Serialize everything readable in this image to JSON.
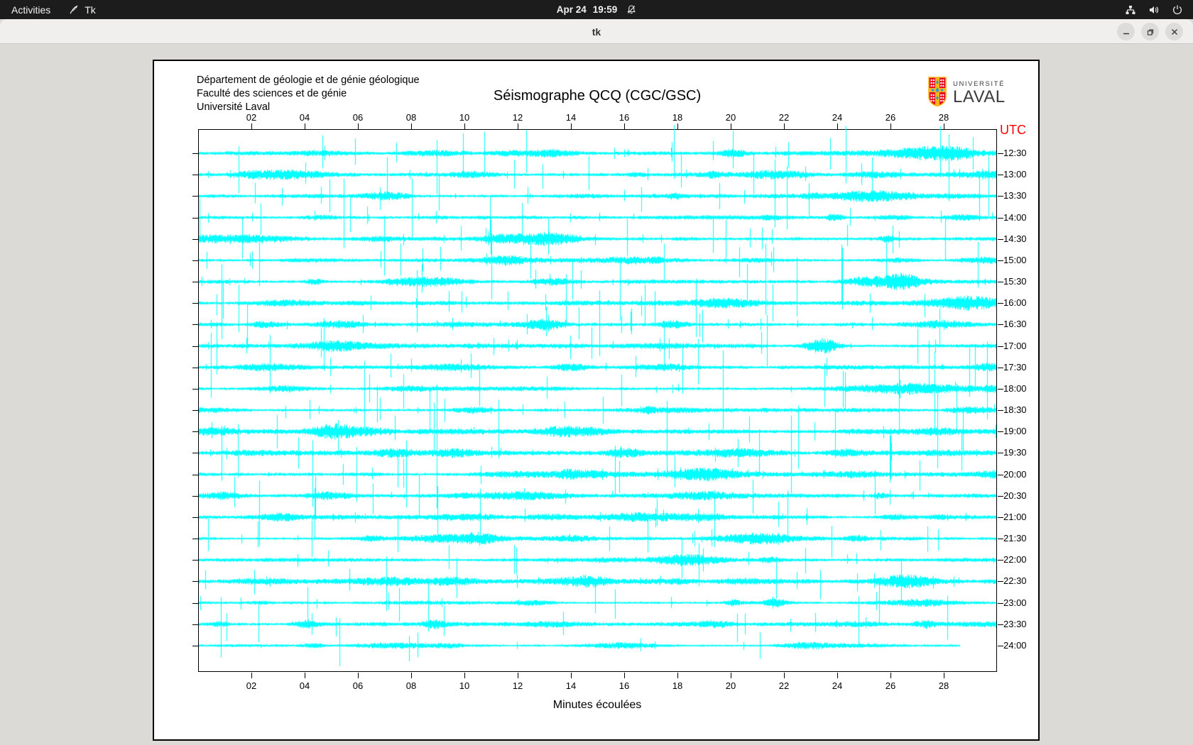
{
  "top_bar": {
    "activities_label": "Activities",
    "app_indicator_label": "Tk",
    "clock_date": "Apr 24",
    "clock_time": "19:59"
  },
  "window": {
    "title": "tk"
  },
  "seismograph": {
    "header_lines": [
      "Département de géologie et de génie géologique",
      "Faculté des sciences et de génie",
      "Université Laval"
    ],
    "title": "Séismographe QCQ (CGC/GSC)",
    "xlabel": "Minutes écoulées",
    "utc_label": "UTC",
    "logo": {
      "line1": "UNIVERSITÉ",
      "line2": "LAVAL"
    },
    "colors": {
      "trace": "#00ffff",
      "utc_label": "#ff0000",
      "frame": "#000000"
    },
    "x_ticks": [
      "02",
      "04",
      "06",
      "08",
      "10",
      "12",
      "14",
      "16",
      "18",
      "20",
      "22",
      "24",
      "26",
      "28"
    ],
    "rows": [
      {
        "label": "12:30",
        "seed": 9011,
        "act": 1.05,
        "spikes": 26
      },
      {
        "label": "13:00",
        "seed": 1457,
        "act": 1.1,
        "spikes": 30
      },
      {
        "label": "13:30",
        "seed": 7321,
        "act": 1.0,
        "spikes": 24
      },
      {
        "label": "14:00",
        "seed": 2893,
        "act": 1.05,
        "spikes": 22
      },
      {
        "label": "14:30",
        "seed": 5512,
        "act": 1.15,
        "spikes": 28
      },
      {
        "label": "15:00",
        "seed": 8123,
        "act": 1.0,
        "spikes": 20
      },
      {
        "label": "15:30",
        "seed": 4671,
        "act": 1.05,
        "spikes": 25
      },
      {
        "label": "16:00",
        "seed": 3339,
        "act": 1.1,
        "spikes": 27
      },
      {
        "label": "16:30",
        "seed": 6104,
        "act": 1.1,
        "spikes": 30
      },
      {
        "label": "17:00",
        "seed": 9842,
        "act": 1.05,
        "spikes": 26
      },
      {
        "label": "17:30",
        "seed": 1276,
        "act": 1.0,
        "spikes": 23
      },
      {
        "label": "18:00",
        "seed": 7583,
        "act": 1.05,
        "spikes": 25
      },
      {
        "label": "18:30",
        "seed": 2431,
        "act": 1.0,
        "spikes": 21
      },
      {
        "label": "19:00",
        "seed": 5928,
        "act": 1.2,
        "spikes": 27
      },
      {
        "label": "19:30",
        "seed": 8765,
        "act": 1.05,
        "spikes": 24
      },
      {
        "label": "20:00",
        "seed": 4210,
        "act": 1.1,
        "spikes": 28
      },
      {
        "label": "20:30",
        "seed": 3014,
        "act": 0.95,
        "spikes": 20
      },
      {
        "label": "21:00",
        "seed": 6667,
        "act": 1.0,
        "spikes": 24
      },
      {
        "label": "21:30",
        "seed": 9450,
        "act": 0.95,
        "spikes": 21
      },
      {
        "label": "22:00",
        "seed": 1598,
        "act": 0.9,
        "spikes": 18
      },
      {
        "label": "22:30",
        "seed": 7034,
        "act": 1.05,
        "spikes": 24
      },
      {
        "label": "23:00",
        "seed": 2750,
        "act": 0.9,
        "spikes": 17
      },
      {
        "label": "23:30",
        "seed": 5381,
        "act": 1.0,
        "spikes": 19
      },
      {
        "label": "24:00",
        "seed": 8896,
        "act": 0.75,
        "spikes": 12,
        "end_fraction": 0.955
      }
    ]
  },
  "chart_data": {
    "type": "line",
    "subtype": "helicorder-seismogram",
    "title": "Séismographe QCQ (CGC/GSC)",
    "xlabel": "Minutes écoulées",
    "x_range_minutes": [
      0,
      30
    ],
    "x_tick_labels": [
      "02",
      "04",
      "06",
      "08",
      "10",
      "12",
      "14",
      "16",
      "18",
      "20",
      "22",
      "24",
      "26",
      "28"
    ],
    "y_axis_label": "UTC",
    "row_labels_utc": [
      "12:30",
      "13:00",
      "13:30",
      "14:00",
      "14:30",
      "15:00",
      "15:30",
      "16:00",
      "16:30",
      "17:00",
      "17:30",
      "18:00",
      "18:30",
      "19:00",
      "19:30",
      "20:00",
      "20:30",
      "21:00",
      "21:30",
      "22:00",
      "22:30",
      "23:00",
      "23:30",
      "24:00"
    ],
    "row_interval_minutes": 30,
    "trace_color": "#00ffff",
    "legend": "none",
    "grid": "off",
    "note": "24 continuous half-hour seismic traces (noise band with impulsive spikes); last trace (24:00) is incomplete, ending near minute 28.7"
  }
}
